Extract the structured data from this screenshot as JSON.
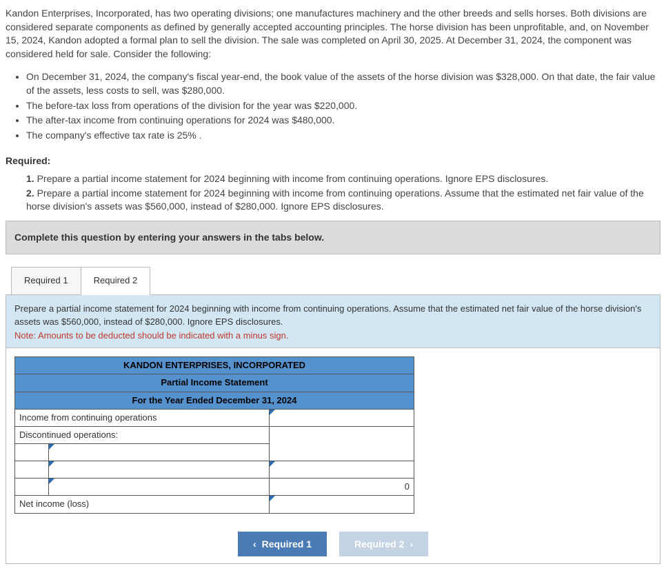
{
  "problem": {
    "intro": "Kandon Enterprises, Incorporated, has two operating divisions; one manufactures machinery and the other breeds and sells horses. Both divisions are considered separate components as defined by generally accepted accounting principles. The horse division has been unprofitable, and, on November 15, 2024, Kandon adopted a formal plan to sell the division. The sale was completed on April 30, 2025. At December 31, 2024, the component was considered held for sale. Consider the following:",
    "facts": [
      "On December 31, 2024, the company's fiscal year-end, the book value of the assets of the horse division was $328,000. On that date, the fair value of the assets, less costs to sell, was $280,000.",
      "The before-tax loss from operations of the division for the year was $220,000.",
      "The after-tax income from continuing operations for 2024 was $480,000.",
      "The company's effective tax rate is 25% ."
    ]
  },
  "required": {
    "heading": "Required:",
    "items": [
      "Prepare a partial income statement for 2024 beginning with income from continuing operations. Ignore EPS disclosures.",
      "Prepare a partial income statement for 2024 beginning with income from continuing operations. Assume that the estimated net fair value of the horse division's assets was $560,000, instead of $280,000. Ignore EPS disclosures."
    ]
  },
  "instruction_bar": "Complete this question by entering your answers in the tabs below.",
  "tabs": {
    "t1": "Required 1",
    "t2": "Required 2"
  },
  "panel": {
    "desc": "Prepare a partial income statement for 2024 beginning with income from continuing operations. Assume that the estimated net fair value of the horse division's assets was $560,000, instead of $280,000. Ignore EPS disclosures.",
    "note": "Note: Amounts to be deducted should be indicated with a minus sign."
  },
  "statement": {
    "title": "KANDON ENTERPRISES, INCORPORATED",
    "subtitle": "Partial Income Statement",
    "period": "For the Year Ended December 31, 2024",
    "row_income_cont": "Income from continuing operations",
    "row_disc": "Discontinued operations:",
    "summary_value": "0",
    "row_net": "Net income (loss)"
  },
  "nav": {
    "prev": "Required 1",
    "next": "Required 2"
  }
}
